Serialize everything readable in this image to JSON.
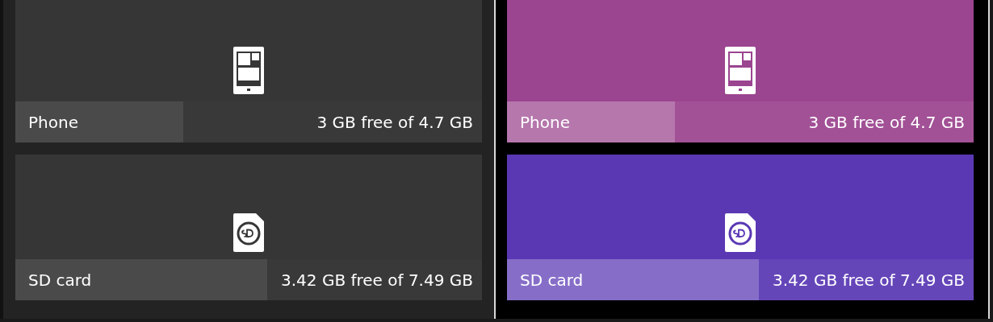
{
  "panels": [
    {
      "kind": "plain",
      "devices": [
        {
          "kind": "phone",
          "name": "Phone",
          "reading": "3 GB free of 4.7 GB",
          "level": 0.36,
          "color": "#363636"
        },
        {
          "kind": "sd",
          "name": "SD card",
          "reading": "3.42 GB free of 7.49 GB",
          "level": 0.54,
          "color": "#363636"
        }
      ]
    },
    {
      "kind": "accent",
      "devices": [
        {
          "kind": "phone",
          "name": "Phone",
          "reading": "3 GB free of 4.7 GB",
          "level": 0.36,
          "color": "#9b448f"
        },
        {
          "kind": "sd",
          "name": "SD card",
          "reading": "3.42 GB free of 7.49 GB",
          "level": 0.54,
          "color": "#5a38b4"
        }
      ]
    }
  ]
}
